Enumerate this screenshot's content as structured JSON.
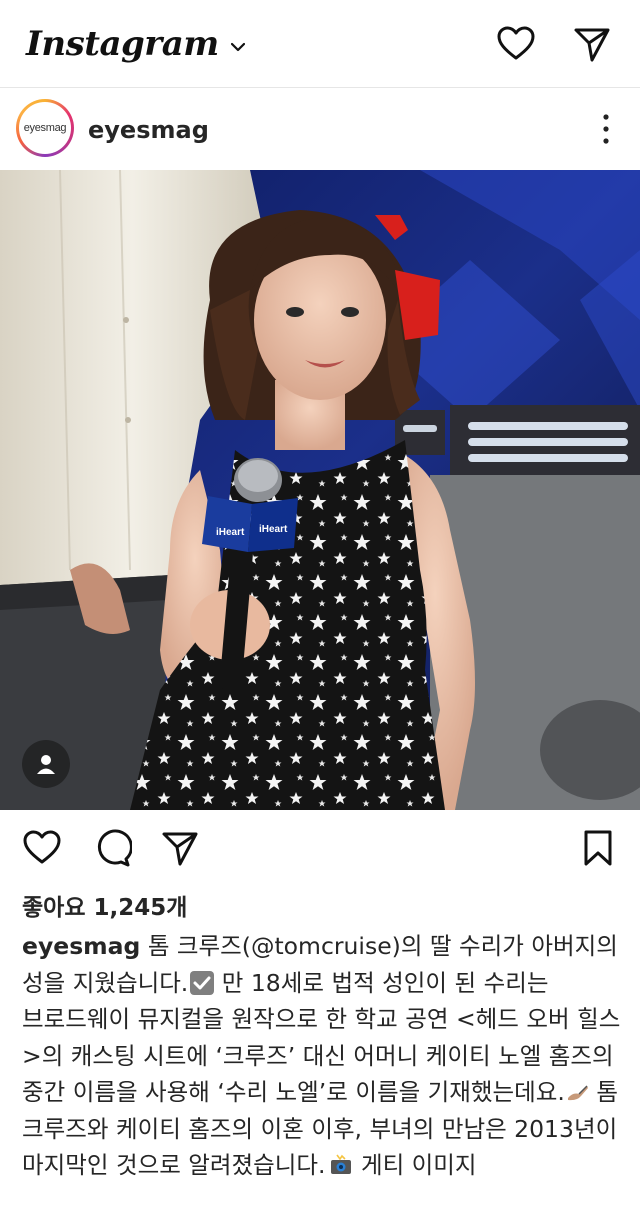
{
  "app": {
    "logo": "Instagram"
  },
  "header": {
    "heart_icon": "heart-outline-icon",
    "send_icon": "paper-plane-icon"
  },
  "post": {
    "avatar_text": "eyesmag",
    "username": "eyesmag",
    "likes": "좋아요 1,245개",
    "caption": {
      "username": "eyesmag",
      "parts": {
        "p1": "톰 크루즈(",
        "mention": "@tomcruise",
        "p2": ")의 딸 수리가 아버지의 성을 지웠습니다.",
        "p3": " 만 18세로 법적 성인이 된 수리는 브로드웨이 뮤지컬을 원작으로 한 학교 공연 <헤드 오버 힐스>의 캐스팅 시트에 ‘크루즈’ 대신 어머니 케이티 노엘 홈즈의 중간 이름을 사용해 ‘수리 노엘’로 이름을 기재했는데요.",
        "p4": " 톰 크루즈와 케이티 홈즈의 이혼 이후, 부녀의 만남은 2013년이 마지막인 것으로 알려졌습니다.",
        "p5": " 게티 이미지"
      }
    }
  },
  "colors": {
    "text": "#262626",
    "divider": "#e6e6e6",
    "stage_blue": "#1b2f8a",
    "dress": "#151515",
    "ribbon": "#d8201c"
  }
}
